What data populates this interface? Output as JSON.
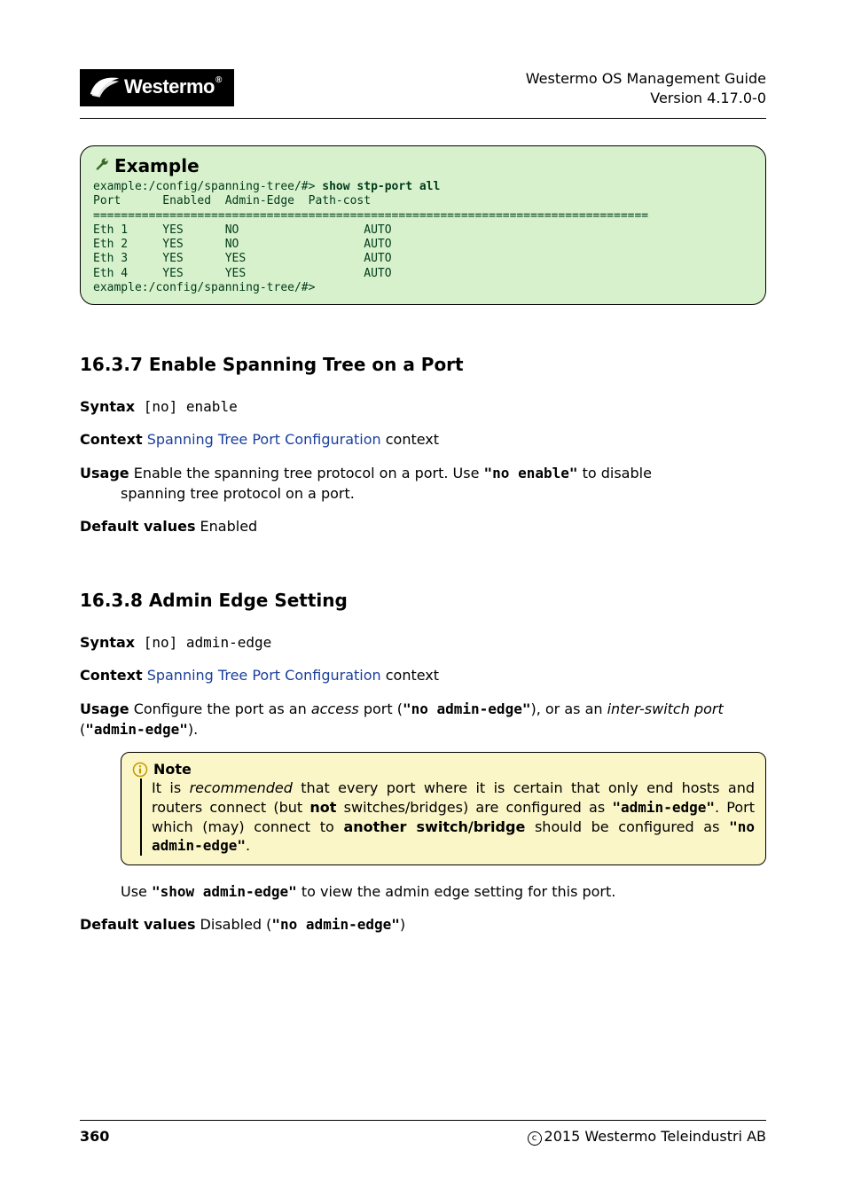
{
  "header": {
    "title_line1": "Westermo OS Management Guide",
    "title_line2": "Version 4.17.0-0",
    "logo_text": "Westermo"
  },
  "example": {
    "title": "Example",
    "prompt1": "example:/config/spanning-tree/#> ",
    "cmd1": "show stp-port all",
    "header_row": "Port      Enabled  Admin-Edge  Path-cost",
    "sep": "================================================================================",
    "rows": [
      "Eth 1     YES      NO                  AUTO",
      "Eth 2     YES      NO                  AUTO",
      "Eth 3     YES      YES                 AUTO",
      "Eth 4     YES      YES                 AUTO"
    ],
    "prompt2": "example:/config/spanning-tree/#>"
  },
  "section1": {
    "heading": "16.3.7   Enable Spanning Tree on a Port",
    "syntax_label": "Syntax",
    "syntax_value": " [no] enable",
    "context_label": "Context",
    "context_link": "Spanning Tree Port Configuration",
    "context_suffix": " context",
    "usage_label": "Usage",
    "usage_text_pre": " Enable the spanning tree protocol on a port. Use ",
    "usage_cmd": "\"no enable\"",
    "usage_text_post": " to disable",
    "usage_line2": "spanning tree protocol on a port.",
    "default_label": "Default values",
    "default_value": " Enabled"
  },
  "section2": {
    "heading": "16.3.8   Admin Edge Setting",
    "syntax_label": "Syntax",
    "syntax_value": " [no] admin-edge",
    "context_label": "Context",
    "context_link": "Spanning Tree Port Configuration",
    "context_suffix": " context",
    "usage_label": "Usage",
    "usage_pre": " Configure the port as an ",
    "usage_it1": "access",
    "usage_mid1": " port (",
    "usage_cmd1": "\"no admin-edge\"",
    "usage_mid2": "), or as an ",
    "usage_it2": "inter-switch port",
    "usage_mid3": " (",
    "usage_cmd2": "\"admin-edge\"",
    "usage_mid4": ").",
    "note_title": "Note",
    "note_t1": "It is ",
    "note_it1": "recommended",
    "note_t2": " that every port where it is certain that only end hosts and routers connect (but ",
    "note_b1": "not",
    "note_t3": " switches/bridges) are configured as ",
    "note_c1": "\"admin-edge\"",
    "note_t4": ".  Port which (may) connect to ",
    "note_b2": "another switch/bridge",
    "note_t5": " should be configured as ",
    "note_c2": "\"no admin-edge\"",
    "note_t6": ".",
    "post_note_pre": "Use ",
    "post_note_cmd": "\"show admin-edge\"",
    "post_note_post": " to view the admin edge setting for this port.",
    "default_label": "Default values",
    "default_pre": " Disabled (",
    "default_cmd": "\"no admin-edge\"",
    "default_post": ")"
  },
  "footer": {
    "page": "360",
    "copyright": "2015 Westermo Teleindustri AB"
  }
}
